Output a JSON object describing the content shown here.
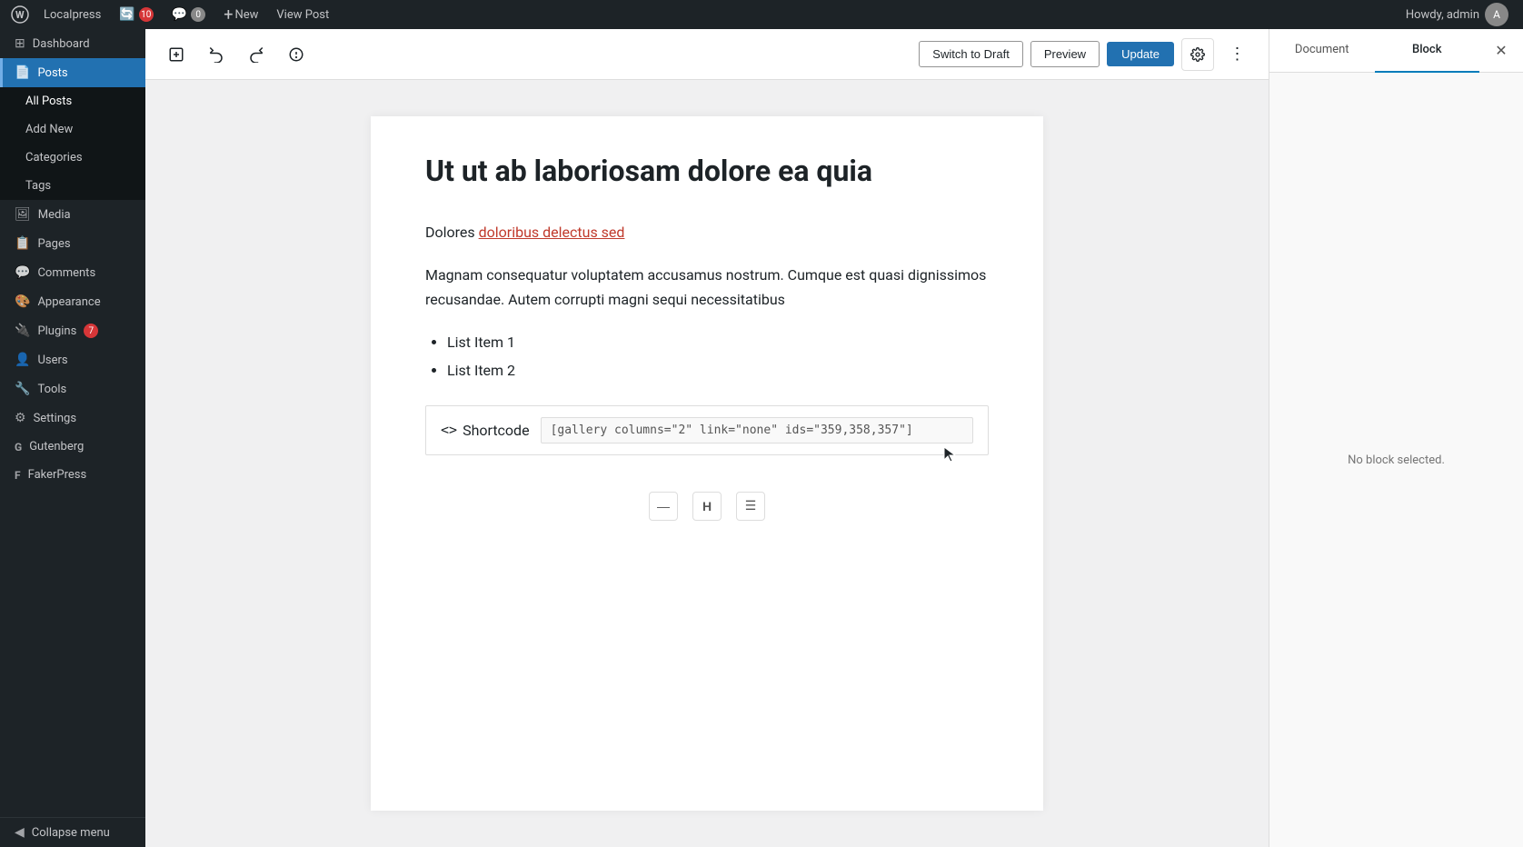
{
  "adminbar": {
    "logo": "W",
    "site_name": "Localpress",
    "updates_count": "10",
    "comments_count": "0",
    "plus_label": "+",
    "new_label": "New",
    "view_post_label": "View Post",
    "howdy_label": "Howdy, admin"
  },
  "sidebar": {
    "brand_label": "Localpress",
    "items": [
      {
        "id": "dashboard",
        "label": "Dashboard",
        "icon": "⊞"
      },
      {
        "id": "posts",
        "label": "Posts",
        "icon": "📄",
        "active": true
      },
      {
        "id": "all-posts",
        "label": "All Posts",
        "active_sub": true
      },
      {
        "id": "add-new",
        "label": "Add New"
      },
      {
        "id": "categories",
        "label": "Categories"
      },
      {
        "id": "tags",
        "label": "Tags"
      },
      {
        "id": "media",
        "label": "Media",
        "icon": "🖼"
      },
      {
        "id": "pages",
        "label": "Pages",
        "icon": "📋"
      },
      {
        "id": "comments",
        "label": "Comments",
        "icon": "💬"
      },
      {
        "id": "appearance",
        "label": "Appearance",
        "icon": "🎨"
      },
      {
        "id": "plugins",
        "label": "Plugins",
        "icon": "🔌",
        "badge": "7"
      },
      {
        "id": "users",
        "label": "Users",
        "icon": "👤"
      },
      {
        "id": "tools",
        "label": "Tools",
        "icon": "🔧"
      },
      {
        "id": "settings",
        "label": "Settings",
        "icon": "⚙"
      },
      {
        "id": "gutenberg",
        "label": "Gutenberg",
        "icon": "G"
      },
      {
        "id": "fakerpress",
        "label": "FakerPress",
        "icon": "F"
      },
      {
        "id": "collapse",
        "label": "Collapse menu",
        "icon": "◀"
      }
    ]
  },
  "toolbar": {
    "add_block_title": "Add block",
    "undo_title": "Undo",
    "redo_title": "Redo",
    "info_title": "Details",
    "switch_draft_label": "Switch to Draft",
    "preview_label": "Preview",
    "update_label": "Update",
    "settings_title": "Settings",
    "more_title": "More tools & options"
  },
  "editor": {
    "post_title": "Ut ut ab laboriosam dolore ea quia",
    "paragraph1": "Dolores ",
    "paragraph1_link_text": "doloribus delectus sed",
    "paragraph2": "Magnam consequatur voluptatem accusamus nostrum. Cumque est quasi dignissimos recusandae. Autem corrupti magni sequi necessitatibus",
    "list_items": [
      "List Item 1",
      "List Item 2"
    ],
    "shortcode_icon_label": "<>",
    "shortcode_label": "Shortcode",
    "shortcode_value": "[gallery columns=\"2\" link=\"none\" ids=\"359,358,357\"]"
  },
  "right_panel": {
    "document_tab": "Document",
    "block_tab": "Block",
    "no_block_label": "No block selected.",
    "close_title": "Close settings"
  }
}
